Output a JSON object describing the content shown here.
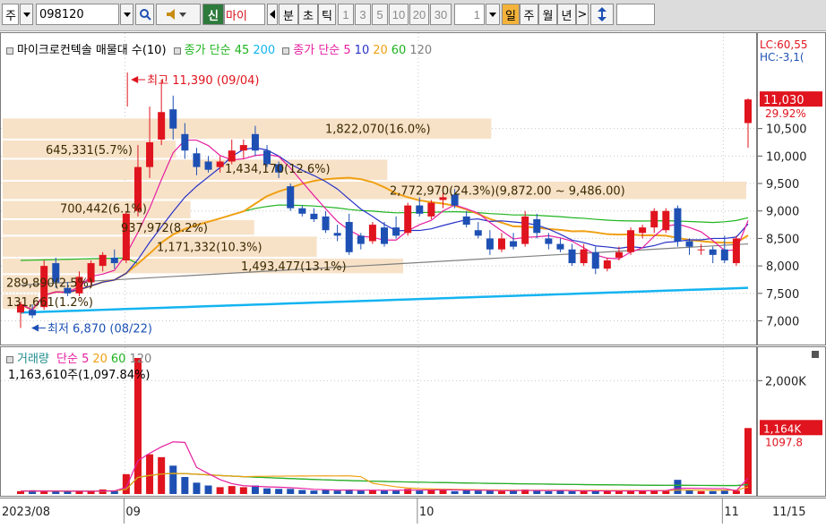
{
  "toolbar": {
    "market": "주",
    "code": "098120",
    "sin": "신",
    "name_short": "마이",
    "tab_bun": "분",
    "tab_cho": "초",
    "tab_tick": "틱",
    "nums": [
      "1",
      "3",
      "5",
      "10",
      "20",
      "30"
    ],
    "count": "1",
    "tab_day": "일",
    "tab_week": "주",
    "tab_month": "월",
    "tab_year": "년",
    "next": ">"
  },
  "legend": {
    "title": "마이크로컨텍솔 매물대 수(10)",
    "close_simple_1": "종가 단순 45",
    "close_simple_1_b": "200",
    "close_simple_2": "종가 단순 5",
    "p10": "10",
    "p20": "20",
    "p60": "60",
    "p120": "120",
    "lc": "LC:60,55",
    "hc": "HC:-3,1("
  },
  "volume_legend": {
    "title": "거래량",
    "ma": "단순 5",
    "p20": "20",
    "p60": "60",
    "p120": "120",
    "current": "1,163,610주(1,097.84%)"
  },
  "annotations": {
    "high": "최고 11,390 (09/04)",
    "low": "최저 6,870 (08/22)",
    "range": "2,772,970(24.3%)(9,872.00 ~ 9,486.00)"
  },
  "price_tags": {
    "last": "11,030",
    "change": "29.92%",
    "vol_last": "1,164K",
    "vol_pct": "1097.8"
  },
  "colors": {
    "up": "#e0141e",
    "down": "#1e50b4",
    "ma5": "#e61ea0",
    "ma10": "#2832c8",
    "ma20": "#f0a014",
    "ma60": "#1eb41e",
    "ma120": "#808080",
    "ma200": "#14b4f0",
    "profile": "#f7e2c8"
  },
  "chart_data": {
    "type": "candlestick",
    "ylim": [
      6650,
      11700
    ],
    "yticks": [
      "7,000",
      "7,500",
      "8,000",
      "8,500",
      "9,000",
      "9,500",
      "10,000",
      "10,500"
    ],
    "x_labels": [
      "2023/08",
      "09",
      "10",
      "11",
      "11/15"
    ],
    "candles": [
      {
        "o": 7150,
        "h": 7350,
        "l": 6870,
        "c": 7300
      },
      {
        "o": 7200,
        "h": 7300,
        "l": 7050,
        "c": 7100
      },
      {
        "o": 7250,
        "h": 8100,
        "l": 7200,
        "c": 8000
      },
      {
        "o": 8050,
        "h": 8150,
        "l": 7600,
        "c": 7700
      },
      {
        "o": 7600,
        "h": 7700,
        "l": 7450,
        "c": 7500
      },
      {
        "o": 7500,
        "h": 7900,
        "l": 7450,
        "c": 7800
      },
      {
        "o": 7700,
        "h": 8100,
        "l": 7600,
        "c": 8050
      },
      {
        "o": 8000,
        "h": 8250,
        "l": 7900,
        "c": 8200
      },
      {
        "o": 8150,
        "h": 8300,
        "l": 7950,
        "c": 8050
      },
      {
        "o": 8100,
        "h": 9000,
        "l": 8050,
        "c": 8950
      },
      {
        "o": 9000,
        "h": 10200,
        "l": 8900,
        "c": 9800
      },
      {
        "o": 9800,
        "h": 10900,
        "l": 9600,
        "c": 10250
      },
      {
        "o": 10300,
        "h": 11390,
        "l": 10200,
        "c": 10800
      },
      {
        "o": 10850,
        "h": 11100,
        "l": 10300,
        "c": 10500
      },
      {
        "o": 10400,
        "h": 10600,
        "l": 9950,
        "c": 10100
      },
      {
        "o": 10050,
        "h": 10150,
        "l": 9650,
        "c": 9800
      },
      {
        "o": 9900,
        "h": 10000,
        "l": 9700,
        "c": 9750
      },
      {
        "o": 9800,
        "h": 10000,
        "l": 9700,
        "c": 9900
      },
      {
        "o": 9900,
        "h": 10300,
        "l": 9850,
        "c": 10100
      },
      {
        "o": 10100,
        "h": 10300,
        "l": 9950,
        "c": 10200
      },
      {
        "o": 10400,
        "h": 10550,
        "l": 10000,
        "c": 10100
      },
      {
        "o": 10100,
        "h": 10200,
        "l": 9800,
        "c": 9850
      },
      {
        "o": 9850,
        "h": 9900,
        "l": 9600,
        "c": 9700
      },
      {
        "o": 9450,
        "h": 9500,
        "l": 9000,
        "c": 9050
      },
      {
        "o": 9050,
        "h": 9100,
        "l": 8900,
        "c": 8950
      },
      {
        "o": 8950,
        "h": 9050,
        "l": 8800,
        "c": 8850
      },
      {
        "o": 8900,
        "h": 9000,
        "l": 8600,
        "c": 8650
      },
      {
        "o": 8600,
        "h": 8750,
        "l": 8450,
        "c": 8550
      },
      {
        "o": 8800,
        "h": 8950,
        "l": 8200,
        "c": 8250
      },
      {
        "o": 8550,
        "h": 8600,
        "l": 8300,
        "c": 8400
      },
      {
        "o": 8450,
        "h": 8800,
        "l": 8400,
        "c": 8750
      },
      {
        "o": 8700,
        "h": 8800,
        "l": 8350,
        "c": 8400
      },
      {
        "o": 8700,
        "h": 8900,
        "l": 8500,
        "c": 8550
      },
      {
        "o": 8600,
        "h": 9150,
        "l": 8550,
        "c": 9100
      },
      {
        "o": 9100,
        "h": 9250,
        "l": 8900,
        "c": 8950
      },
      {
        "o": 8900,
        "h": 9200,
        "l": 8850,
        "c": 9150
      },
      {
        "o": 9200,
        "h": 9450,
        "l": 9050,
        "c": 9250
      },
      {
        "o": 9300,
        "h": 9400,
        "l": 9050,
        "c": 9100
      },
      {
        "o": 8900,
        "h": 9000,
        "l": 8700,
        "c": 8750
      },
      {
        "o": 8650,
        "h": 8800,
        "l": 8500,
        "c": 8550
      },
      {
        "o": 8500,
        "h": 8650,
        "l": 8200,
        "c": 8300
      },
      {
        "o": 8300,
        "h": 8600,
        "l": 8250,
        "c": 8500
      },
      {
        "o": 8450,
        "h": 8600,
        "l": 8300,
        "c": 8350
      },
      {
        "o": 8400,
        "h": 9000,
        "l": 8350,
        "c": 8900
      },
      {
        "o": 8850,
        "h": 8950,
        "l": 8500,
        "c": 8600
      },
      {
        "o": 8500,
        "h": 8600,
        "l": 8300,
        "c": 8400
      },
      {
        "o": 8400,
        "h": 8500,
        "l": 8250,
        "c": 8300
      },
      {
        "o": 8300,
        "h": 8400,
        "l": 8000,
        "c": 8050
      },
      {
        "o": 8050,
        "h": 8400,
        "l": 8000,
        "c": 8300
      },
      {
        "o": 8250,
        "h": 8350,
        "l": 7850,
        "c": 7950
      },
      {
        "o": 7950,
        "h": 8150,
        "l": 7900,
        "c": 8100
      },
      {
        "o": 8150,
        "h": 8350,
        "l": 8100,
        "c": 8250
      },
      {
        "o": 8250,
        "h": 8700,
        "l": 8200,
        "c": 8650
      },
      {
        "o": 8600,
        "h": 8750,
        "l": 8500,
        "c": 8700
      },
      {
        "o": 8700,
        "h": 9050,
        "l": 8600,
        "c": 9000
      },
      {
        "o": 8650,
        "h": 9050,
        "l": 8600,
        "c": 9000
      },
      {
        "o": 9050,
        "h": 9100,
        "l": 8350,
        "c": 8450
      },
      {
        "o": 8450,
        "h": 8500,
        "l": 8200,
        "c": 8350
      },
      {
        "o": 8300,
        "h": 8400,
        "l": 8200,
        "c": 8300
      },
      {
        "o": 8300,
        "h": 8350,
        "l": 8050,
        "c": 8200
      },
      {
        "o": 8300,
        "h": 8550,
        "l": 8050,
        "c": 8100
      },
      {
        "o": 8050,
        "h": 8550,
        "l": 8000,
        "c": 8500
      },
      {
        "o": 10600,
        "h": 11050,
        "l": 10150,
        "c": 11030
      }
    ],
    "volume_profile": [
      {
        "low": 7200,
        "high": 7500,
        "volume": 131661,
        "label": "131,661(1.2%)"
      },
      {
        "low": 7500,
        "high": 7850,
        "volume": 289890,
        "label": "289,890(2.5%)"
      },
      {
        "low": 7850,
        "high": 8150,
        "volume": 1493477,
        "label": "1,493,477(13.1%)"
      },
      {
        "low": 8150,
        "high": 8550,
        "volume": 1171332,
        "label": "1,171,332(10.3%)"
      },
      {
        "low": 8550,
        "high": 8850,
        "volume": 937972,
        "label": "937,972(8.2%)"
      },
      {
        "low": 8850,
        "high": 9200,
        "volume": 700442,
        "label": "700,442(6.1%)"
      },
      {
        "low": 9200,
        "high": 9550,
        "volume": 2772970,
        "label": "2,772,970(24.3%)"
      },
      {
        "low": 9550,
        "high": 9950,
        "volume": 1434170,
        "label": "1,434,170(12.6%)"
      },
      {
        "low": 9950,
        "high": 10300,
        "volume": 645331,
        "label": "645,331(5.7%)"
      },
      {
        "low": 10300,
        "high": 10700,
        "volume": 1822070,
        "label": "1,822,070(16.0%)"
      }
    ],
    "volume": {
      "ylim": [
        0,
        2400000
      ],
      "yticks": [
        "2,000K"
      ],
      "values": [
        50000,
        60000,
        45000,
        55000,
        40000,
        45000,
        50000,
        80000,
        60000,
        350000,
        2400000,
        700000,
        650000,
        500000,
        300000,
        200000,
        150000,
        120000,
        140000,
        120000,
        150000,
        100000,
        90000,
        90000,
        70000,
        60000,
        70000,
        60000,
        80000,
        60000,
        70000,
        60000,
        60000,
        90000,
        60000,
        80000,
        80000,
        50000,
        70000,
        60000,
        60000,
        50000,
        60000,
        80000,
        60000,
        50000,
        60000,
        50000,
        50000,
        60000,
        50000,
        50000,
        60000,
        60000,
        70000,
        60000,
        250000,
        70000,
        50000,
        50000,
        60000,
        60000,
        1163610
      ]
    }
  }
}
